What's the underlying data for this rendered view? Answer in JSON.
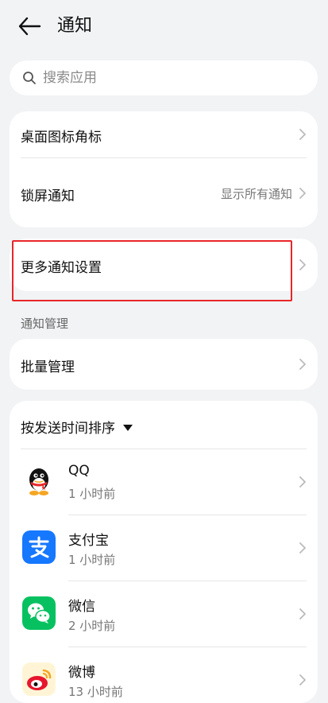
{
  "header": {
    "title": "通知"
  },
  "search": {
    "placeholder": "搜索应用"
  },
  "settings": {
    "desktop_badge": "桌面图标角标",
    "lock_screen": "锁屏通知",
    "lock_screen_value": "显示所有通知",
    "more_settings": "更多通知设置"
  },
  "manage": {
    "section_label": "通知管理",
    "batch": "批量管理"
  },
  "apps": {
    "sort_label": "按发送时间排序",
    "items": [
      {
        "name": "QQ",
        "time": "1 小时前",
        "icon": "qq-icon"
      },
      {
        "name": "支付宝",
        "time": "1 小时前",
        "icon": "alipay-icon"
      },
      {
        "name": "微信",
        "time": "2 小时前",
        "icon": "wechat-icon"
      },
      {
        "name": "微博",
        "time": "13 小时前",
        "icon": "weibo-icon"
      }
    ]
  },
  "colors": {
    "background": "#f1f3f5",
    "card": "#ffffff",
    "highlight": "#e8262a",
    "alipay": "#1677ff",
    "wechat": "#07c160",
    "weibo_red": "#e6162d",
    "weibo_yellow": "#f5c518"
  }
}
